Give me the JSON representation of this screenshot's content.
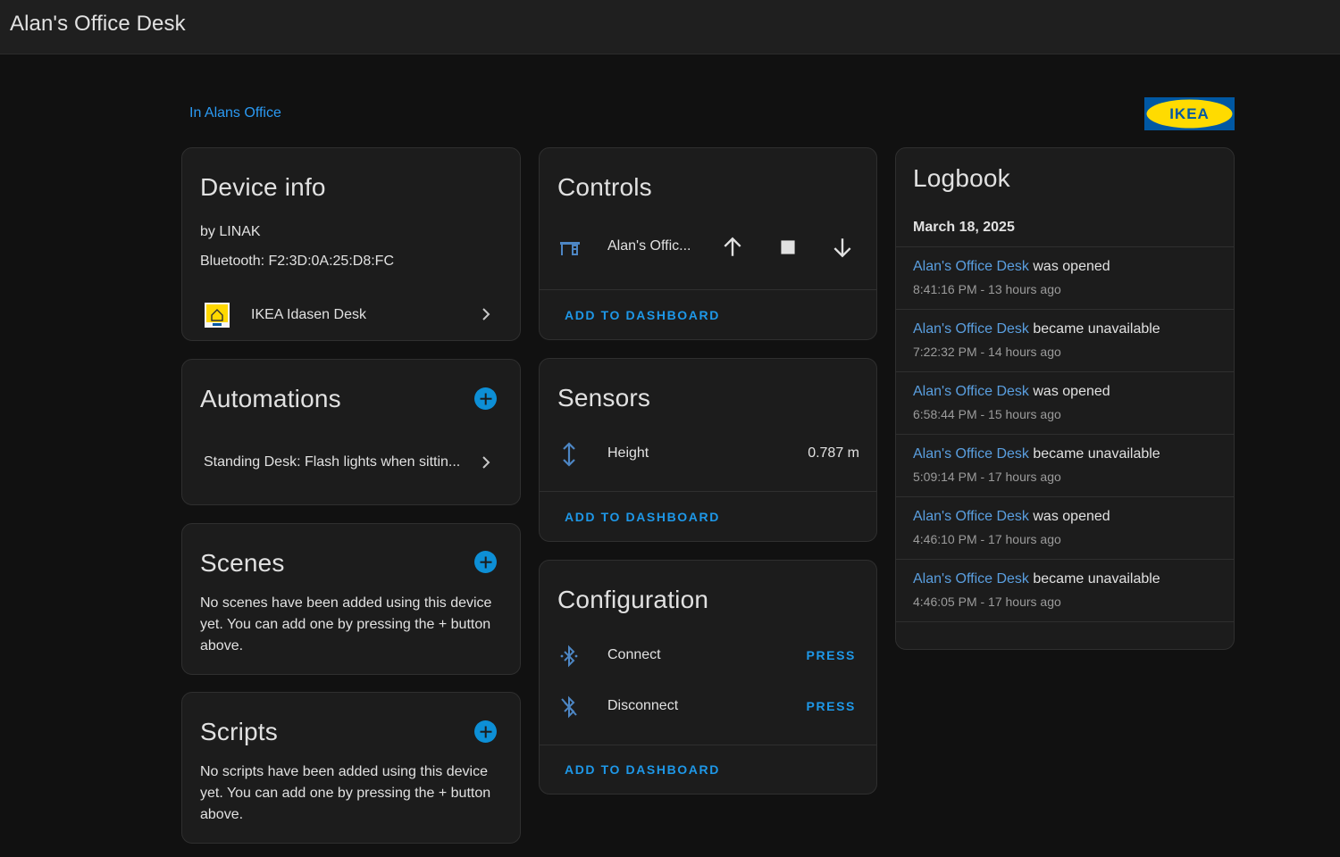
{
  "header": {
    "title": "Alan's Office Desk"
  },
  "area_link": "In Alans Office",
  "brand": {
    "logo_text": "IKEA",
    "logo_bg": "#0058a3",
    "logo_fg": "#ffdb00"
  },
  "colors": {
    "accent": "#1e98e8",
    "link": "#2b9af3",
    "entity": "#5a9fe0",
    "icon": "#4d86c4"
  },
  "device_info": {
    "title": "Device info",
    "manufacturer": "by LINAK",
    "connection": "Bluetooth: F2:3D:0A:25:D8:FC",
    "integration": {
      "name": "IKEA Idasen Desk",
      "icon": "ikea-idasen-icon"
    }
  },
  "automations": {
    "title": "Automations",
    "items": [
      {
        "label": "Standing Desk: Flash lights when sittin..."
      }
    ]
  },
  "scenes": {
    "title": "Scenes",
    "empty_text": "No scenes have been added using this device yet. You can add one by pressing the + button above."
  },
  "scripts": {
    "title": "Scripts",
    "empty_text": "No scripts have been added using this device yet. You can add one by pressing the + button above."
  },
  "controls": {
    "title": "Controls",
    "entity": {
      "name": "Alan's Offic...",
      "icon": "desk-icon"
    },
    "buttons": [
      "arrow-up-icon",
      "stop-icon",
      "arrow-down-icon"
    ],
    "action": "ADD TO DASHBOARD"
  },
  "sensors": {
    "title": "Sensors",
    "items": [
      {
        "name": "Height",
        "value": "0.787 m",
        "icon": "arrow-up-down-icon"
      }
    ],
    "action": "ADD TO DASHBOARD"
  },
  "configuration": {
    "title": "Configuration",
    "items": [
      {
        "name": "Connect",
        "action": "PRESS",
        "icon": "bluetooth-connect-icon"
      },
      {
        "name": "Disconnect",
        "action": "PRESS",
        "icon": "bluetooth-off-icon"
      }
    ],
    "action": "ADD TO DASHBOARD"
  },
  "logbook": {
    "title": "Logbook",
    "date": "March 18, 2025",
    "entries": [
      {
        "entity": "Alan's Office Desk",
        "event": "was opened",
        "time": "8:41:16 PM - 13 hours ago"
      },
      {
        "entity": "Alan's Office Desk",
        "event": "became unavailable",
        "time": "7:22:32 PM - 14 hours ago"
      },
      {
        "entity": "Alan's Office Desk",
        "event": "was opened",
        "time": "6:58:44 PM - 15 hours ago"
      },
      {
        "entity": "Alan's Office Desk",
        "event": "became unavailable",
        "time": "5:09:14 PM - 17 hours ago"
      },
      {
        "entity": "Alan's Office Desk",
        "event": "was opened",
        "time": "4:46:10 PM - 17 hours ago"
      },
      {
        "entity": "Alan's Office Desk",
        "event": "became unavailable",
        "time": "4:46:05 PM - 17 hours ago"
      }
    ]
  }
}
